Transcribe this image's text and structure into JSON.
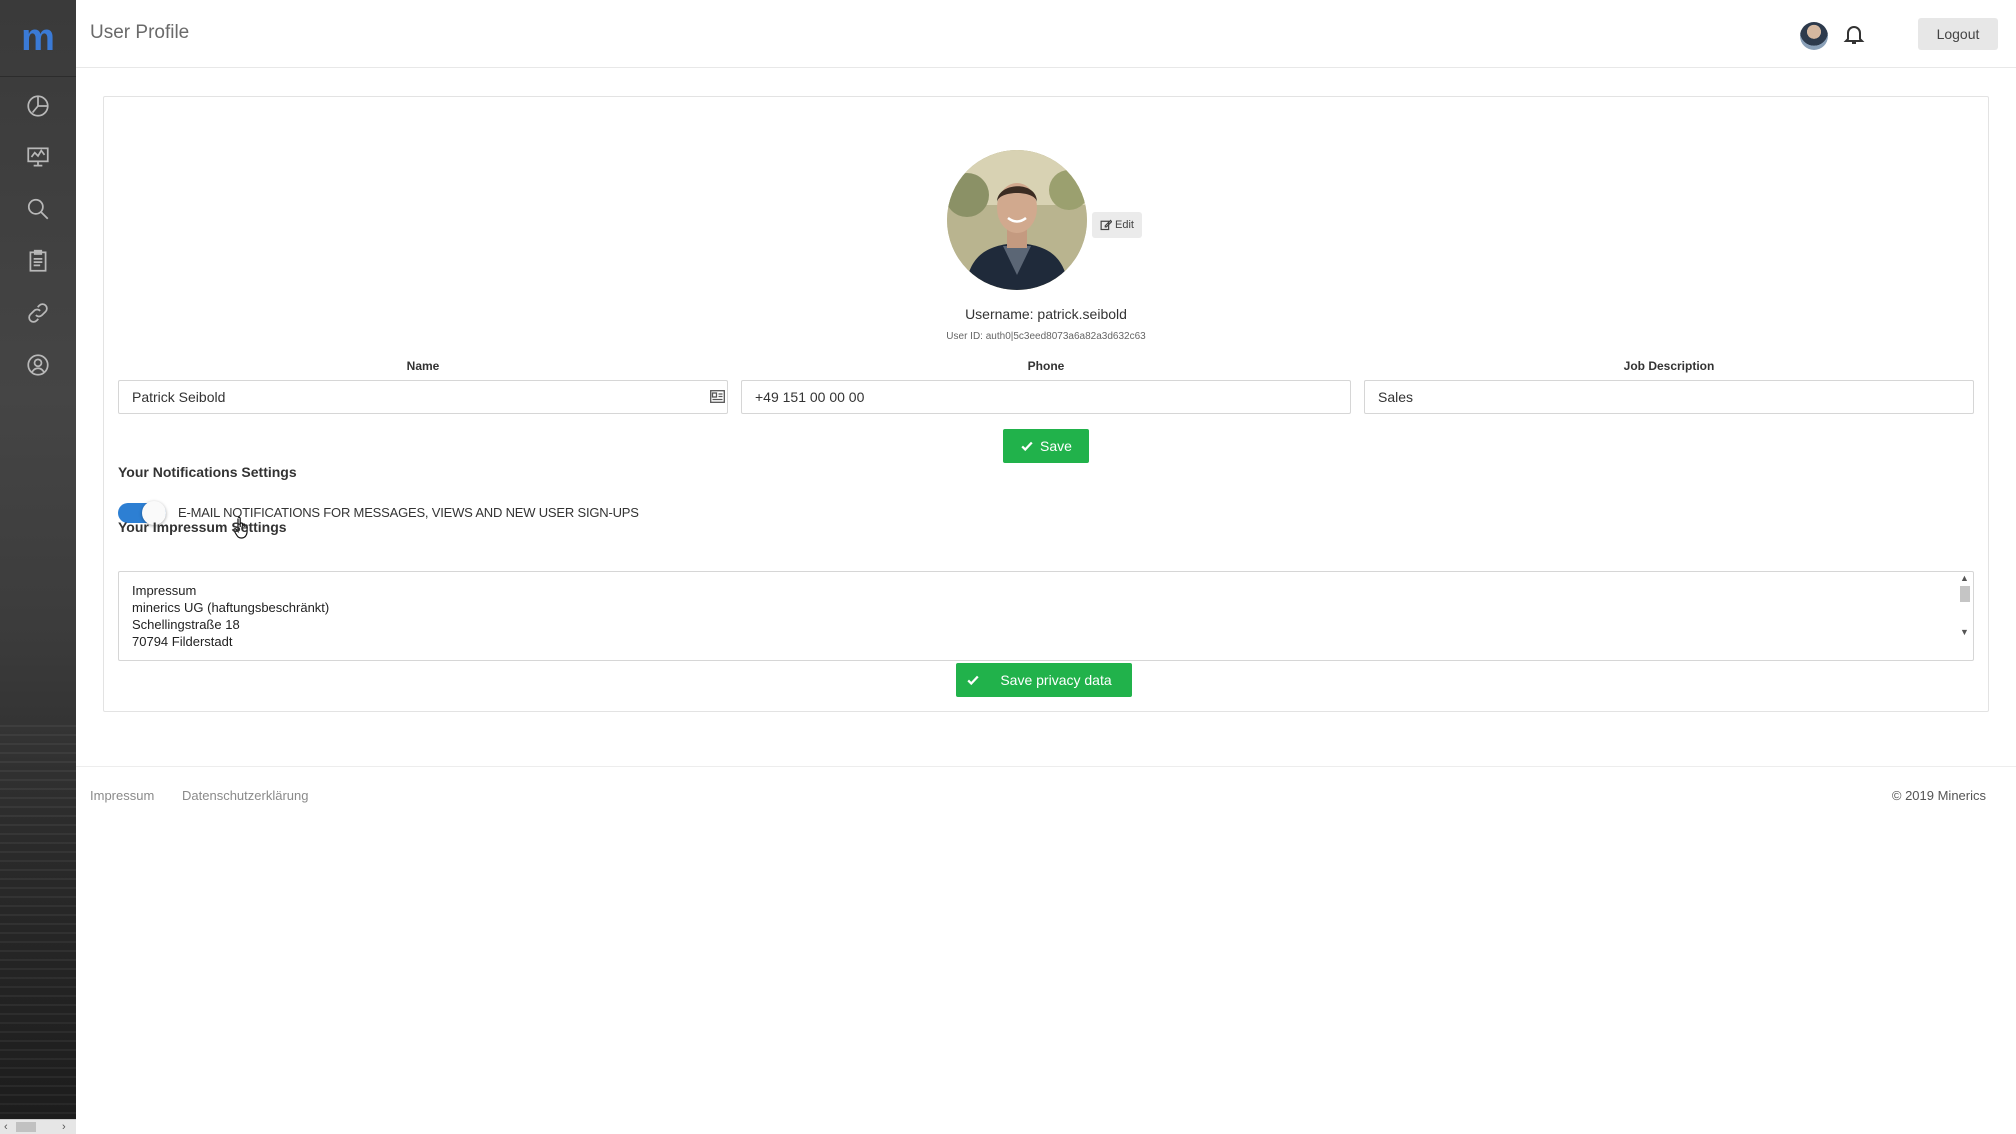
{
  "header": {
    "title": "User Profile",
    "logout_label": "Logout"
  },
  "sidebar": {
    "logo_text": "m",
    "items": [
      {
        "icon": "dashboard-chart-icon"
      },
      {
        "icon": "presentation-icon"
      },
      {
        "icon": "search-icon"
      },
      {
        "icon": "clipboard-icon"
      },
      {
        "icon": "link-icon"
      },
      {
        "icon": "support-icon"
      }
    ]
  },
  "profile": {
    "edit_label": "Edit",
    "username": "Username: patrick.seibold",
    "user_id": "User ID: auth0|5c3eed8073a6a82a3d632c63"
  },
  "form": {
    "name_label": "Name",
    "name_value": "Patrick Seibold",
    "phone_label": "Phone",
    "phone_value": "+49 151 00 00 00",
    "job_label": "Job Description",
    "job_value": "Sales",
    "save_label": "Save"
  },
  "notifications": {
    "title": "Your Notifications Settings",
    "email_toggle_label": "E-MAIL NOTIFICATIONS FOR MESSAGES, VIEWS AND NEW USER SIGN-UPS",
    "email_toggle_on": true
  },
  "impressum": {
    "title": "Your Impressum Settings",
    "text": "Impressum\nminerics UG (haftungsbeschränkt)\nSchellingstraße 18\n70794 Filderstadt",
    "save_label": "Save privacy data"
  },
  "footer": {
    "links": [
      "Impressum",
      "Datenschutzerklärung"
    ],
    "copyright": "© 2019 Minerics"
  },
  "colors": {
    "accent_green": "#21b24b",
    "toggle_blue": "#2d7fd3",
    "logo_blue": "#3a7ad6",
    "sidebar_dark": "#3a3a3a"
  }
}
